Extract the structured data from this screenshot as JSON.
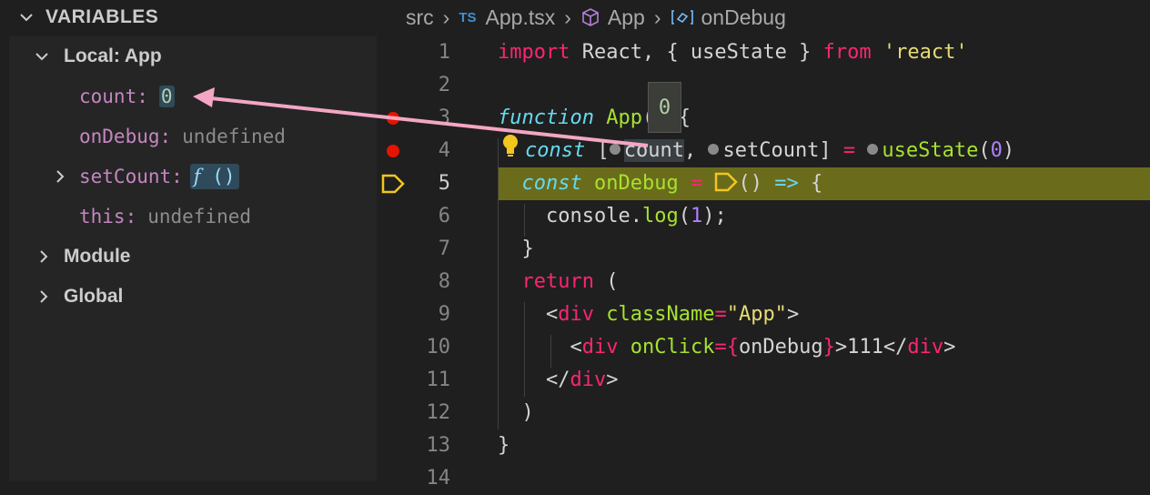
{
  "variables_panel": {
    "title": "VARIABLES",
    "scopes": {
      "local": {
        "label": "Local: App",
        "vars": {
          "count": {
            "name": "count:",
            "value": "0"
          },
          "onDebug": {
            "name": "onDebug:",
            "value": "undefined"
          },
          "setCount": {
            "name": "setCount:",
            "fn_symbol": "f",
            "fn_parens": "()"
          },
          "this": {
            "name": "this:",
            "value": "undefined"
          }
        }
      },
      "module": {
        "label": "Module"
      },
      "global": {
        "label": "Global"
      }
    }
  },
  "breadcrumb": {
    "folder": "src",
    "ts_badge": "TS",
    "file": "App.tsx",
    "component": "App",
    "symbol": "onDebug"
  },
  "editor": {
    "line_numbers": [
      "1",
      "2",
      "3",
      "4",
      "5",
      "6",
      "7",
      "8",
      "9",
      "10",
      "11",
      "12",
      "13",
      "14"
    ],
    "current_line": "5",
    "hover_value": "0",
    "breakpoints_on_lines": [
      "3",
      "4"
    ],
    "paused_line": "5"
  },
  "colors": {
    "annotation_arrow": "#f4a6c4",
    "breakpoint": "#e51400",
    "paused_highlight": "#6b6b1c",
    "paused_marker": "#f2c61f"
  },
  "icons": [
    "chevron-down-icon",
    "chevron-right-icon",
    "cube-icon",
    "symbol-method-icon",
    "lightbulb-icon",
    "breakpoint-icon",
    "debug-pause-arrow-icon"
  ]
}
